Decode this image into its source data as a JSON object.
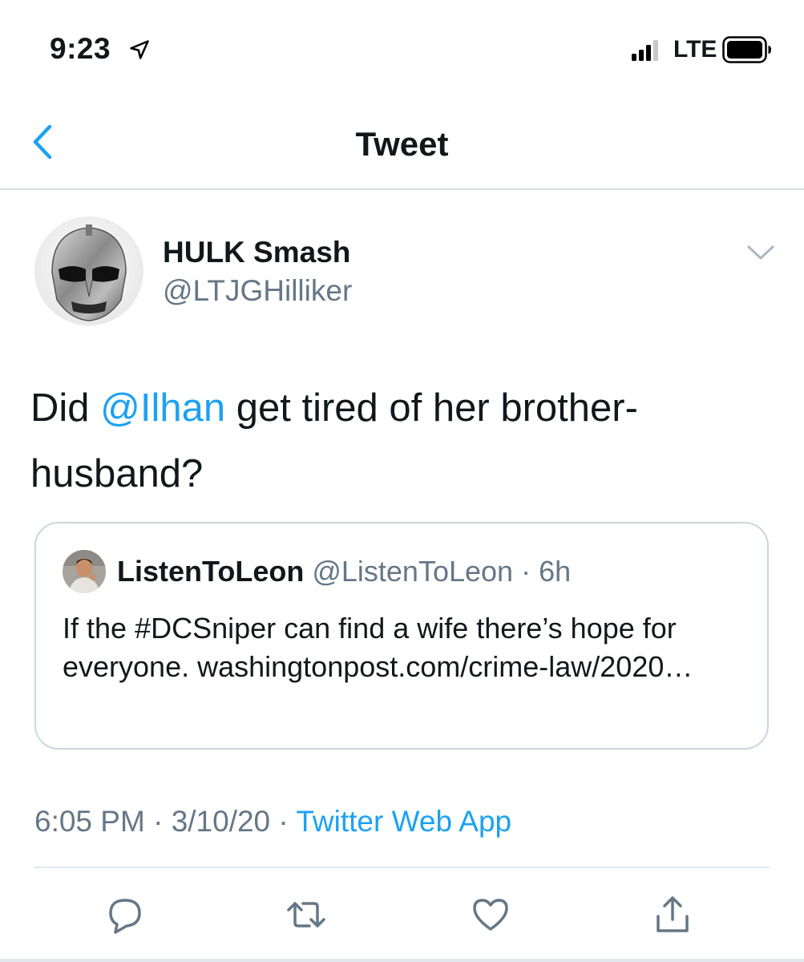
{
  "status_bar": {
    "time": "9:23",
    "carrier": "LTE",
    "icons": [
      "location-arrow-icon",
      "signal-icon",
      "battery-icon"
    ]
  },
  "nav": {
    "title": "Tweet",
    "back_icon": "chevron-left-icon"
  },
  "tweet": {
    "author_name": "HULK Smash",
    "author_handle": "@LTJGHilliker",
    "text_before": "Did ",
    "mention": "@Ilhan",
    "text_after": " get tired of her brother-husband?",
    "timestamp": "6:05 PM",
    "date": "3/10/20",
    "separator": "·",
    "source": "Twitter Web App",
    "quoted": {
      "name": "ListenToLeon",
      "handle": "@ListenToLeon",
      "age": "6h",
      "text": "If the #DCSniper can find a wife there’s hope for everyone. washingtonpost.com/crime-law/2020…"
    }
  },
  "actions": [
    "reply-icon",
    "retweet-icon",
    "like-icon",
    "share-icon"
  ],
  "colors": {
    "accent": "#1da1f2",
    "secondary_text": "#657786",
    "primary_text": "#14171a",
    "divider": "#e1e8ed"
  }
}
